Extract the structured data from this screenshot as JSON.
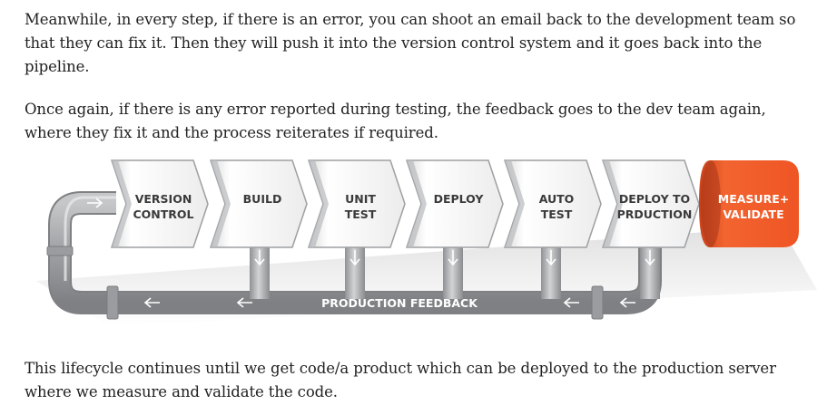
{
  "paragraphs": [
    "Meanwhile, in every step, if there is an error, you can shoot an email back to the development team so that they can fix it. Then they will push it into the version control system and it goes back into the pipeline.",
    "Once again, if there is any error reported during testing, the feedback goes to the dev team again, where they fix it and the process reiterates if required.",
    "This lifecycle continues until we get code/a product which can be deployed to the production server where we measure and validate the code."
  ],
  "diagram": {
    "stages": [
      {
        "line1": "VERSION",
        "line2": "CONTROL"
      },
      {
        "line1": "BUILD",
        "line2": ""
      },
      {
        "line1": "UNIT",
        "line2": "TEST"
      },
      {
        "line1": "DEPLOY",
        "line2": ""
      },
      {
        "line1": "AUTO",
        "line2": "TEST"
      },
      {
        "line1": "DEPLOY TO",
        "line2": "PRDUCTION"
      }
    ],
    "final_stage": {
      "line1": "MEASURE+",
      "line2": "VALIDATE"
    },
    "feedback_label": "PRODUCTION FEEDBACK",
    "colors": {
      "accent": "#f05a28",
      "pipe": "#a9abae",
      "pipe_dark": "#8a8c8f",
      "stage_text": "#3a3a3a"
    }
  }
}
